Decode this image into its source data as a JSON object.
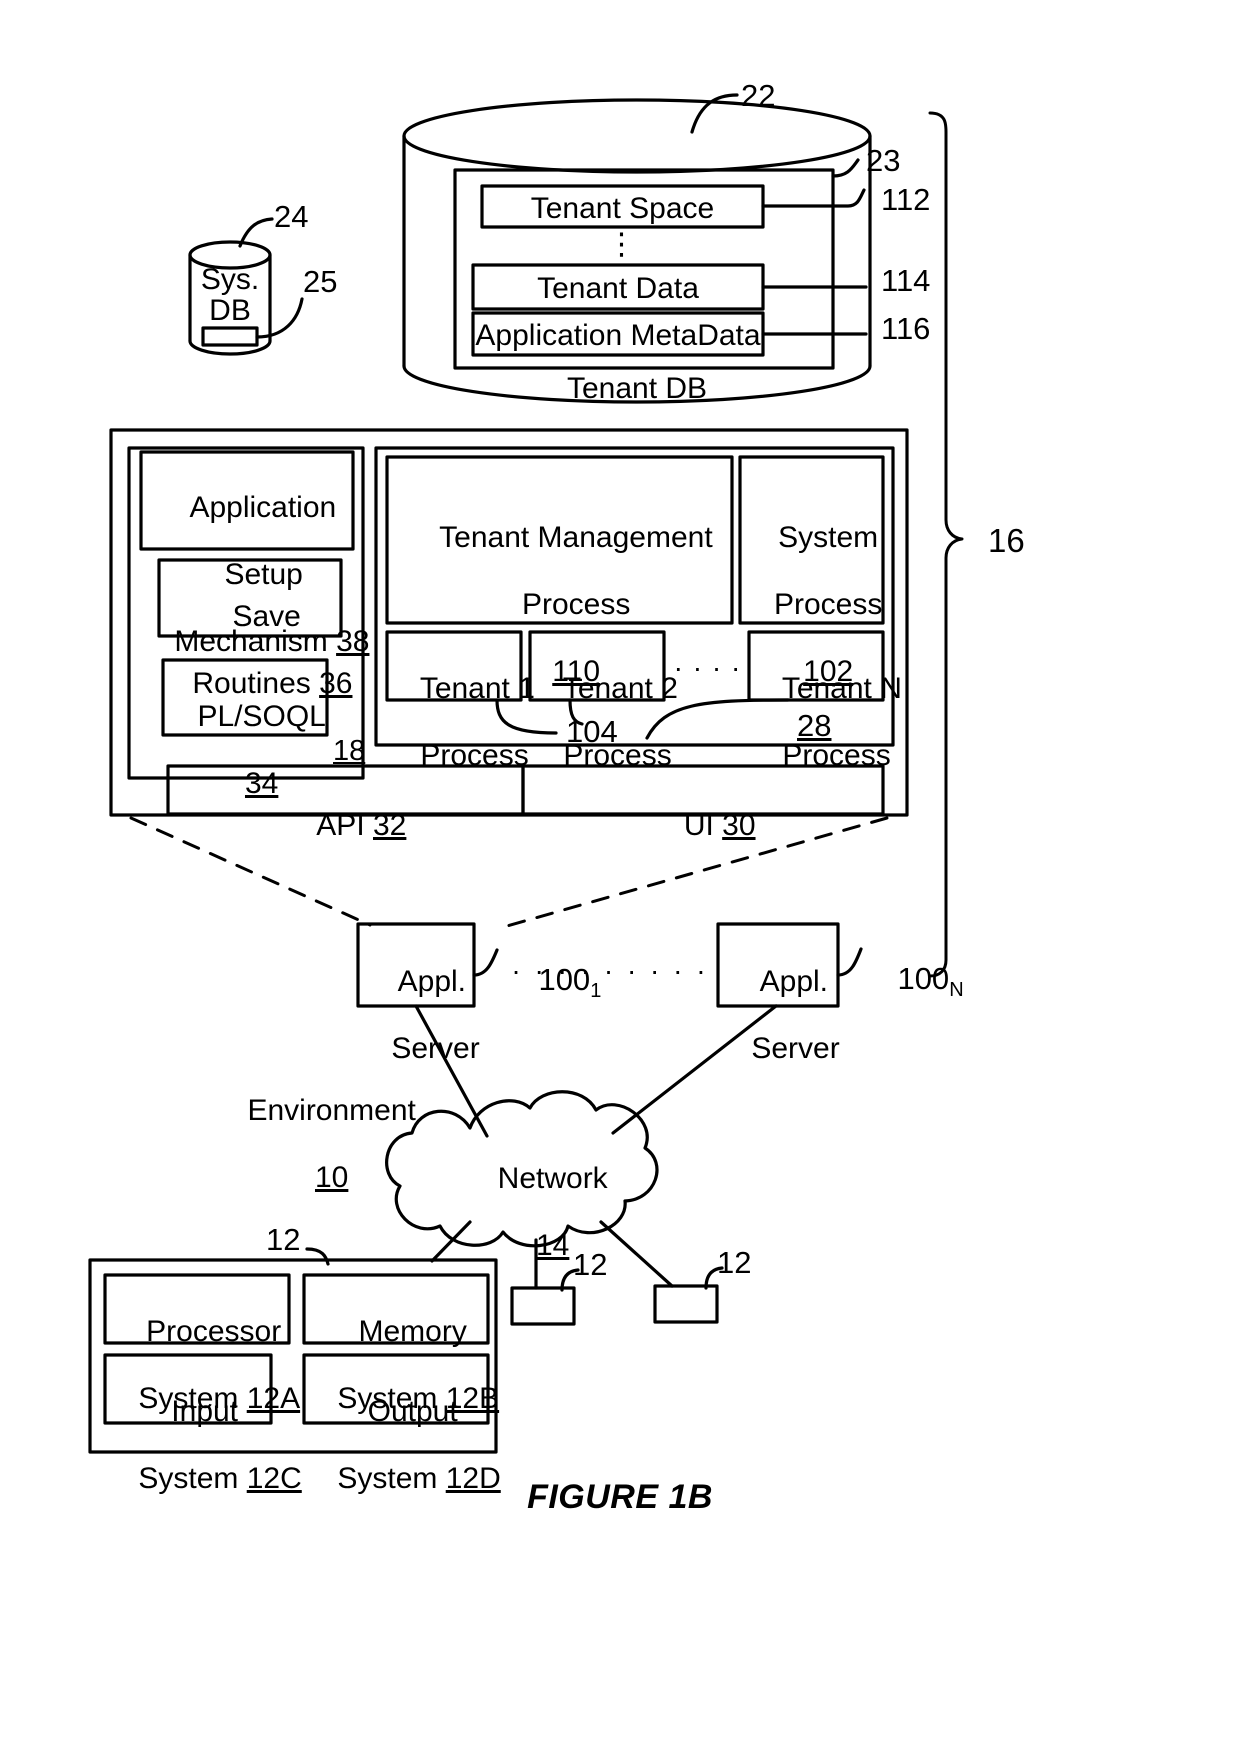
{
  "figure": {
    "caption": "FIGURE 1B",
    "environment_label": "Environment",
    "environment_ref": "10"
  },
  "tenant_db": {
    "title": "Tenant DB",
    "ref": "22",
    "inner_ref": "23",
    "rows": [
      {
        "label": "Tenant Space",
        "ref": "112"
      },
      {
        "label": "Tenant Data",
        "ref": "114"
      },
      {
        "label": "Application MetaData",
        "ref": "116"
      }
    ],
    "ellipsis": "⋮"
  },
  "sys_db": {
    "line1": "Sys.",
    "line2": "DB",
    "ref": "24",
    "inner_ref": "25"
  },
  "system": {
    "ref": "16",
    "process_space_ref": "18",
    "tenant_process_space_ref": "28",
    "tenant_process_ref": "104"
  },
  "app_platform": {
    "setup": {
      "line1": "Application",
      "line2": "Setup",
      "line3": "Mechanism",
      "ref": "38"
    },
    "save": {
      "line1": "Save",
      "line2": "Routines",
      "ref": "36"
    },
    "plsoql": {
      "line1": "PL/SOQL",
      "ref": "34"
    }
  },
  "processes": {
    "tenant_mgmt": {
      "line1": "Tenant Management",
      "line2": "Process",
      "ref": "110"
    },
    "system_process": {
      "line1": "System",
      "line2": "Process",
      "ref": "102"
    },
    "tenants": [
      {
        "line1": "Tenant 1",
        "line2": "Process"
      },
      {
        "line1": "Tenant 2",
        "line2": "Process"
      },
      {
        "line1": "Tenant N",
        "line2": "Process"
      }
    ],
    "dots": "· · · ·"
  },
  "interfaces": {
    "api": {
      "label": "API",
      "ref": "32"
    },
    "ui": {
      "label": "UI",
      "ref": "30"
    }
  },
  "app_servers": [
    {
      "line1": "Appl.",
      "line2": "Server",
      "ref": "100",
      "ref_sub": "1"
    },
    {
      "line1": "Appl.",
      "line2": "Server",
      "ref": "100",
      "ref_sub": "N"
    }
  ],
  "app_server_dots": "· · · · · · · · ·",
  "network": {
    "label": "Network",
    "ref": "14"
  },
  "user_system": {
    "ref": "12",
    "blocks": [
      {
        "line1": "Processor",
        "line2": "System",
        "ref": "12A"
      },
      {
        "line1": "Memory",
        "line2": "System",
        "ref": "12B"
      },
      {
        "line1": "Input",
        "line2": "System",
        "ref": "12C"
      },
      {
        "line1": "Output",
        "line2": "System",
        "ref": "12D"
      }
    ]
  },
  "other_user_systems": [
    {
      "ref": "12"
    },
    {
      "ref": "12"
    }
  ]
}
